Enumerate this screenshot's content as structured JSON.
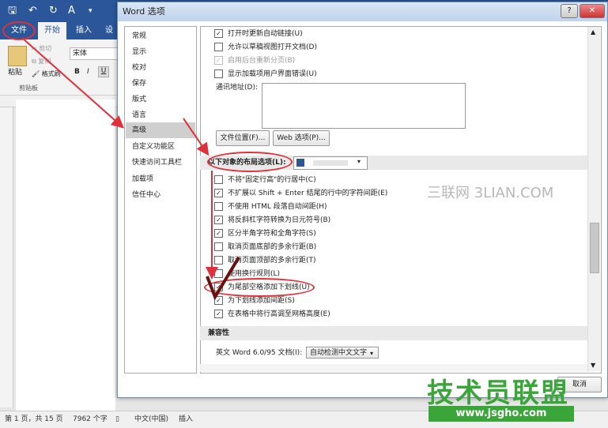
{
  "word": {
    "tabs": [
      "文件",
      "开始",
      "插入",
      "设"
    ],
    "font_name": "宋体",
    "paste_label": "粘贴",
    "cut_label": "剪切",
    "copy_label": "复制",
    "format_painter_label": "格式刷",
    "clipboard_label": "剪贴板",
    "format_buttons": [
      "B",
      "I",
      "U"
    ]
  },
  "status": {
    "page": "第 1 页，共 15 页",
    "words": "7962 个字",
    "language": "中文(中国)",
    "mode": "插入"
  },
  "dialog": {
    "title": "Word 选项",
    "help": "?",
    "close": "✕",
    "cancel_fragment": "取消"
  },
  "nav_items": [
    "常规",
    "显示",
    "校对",
    "保存",
    "版式",
    "语言",
    "高级",
    "自定义功能区",
    "快速访问工具栏",
    "加载项",
    "信任中心"
  ],
  "options_top": [
    {
      "label": "打开时更新自动链接(U)",
      "checked": true,
      "disabled": false
    },
    {
      "label": "允许以草稿视图打开文档(D)",
      "checked": false,
      "disabled": false
    },
    {
      "label": "启用后台重新分页(B)",
      "checked": true,
      "disabled": true
    },
    {
      "label": "显示加载项用户界面错误(U)",
      "checked": false,
      "disabled": false
    }
  ],
  "mail_address_label": "通讯地址(D):",
  "file_locations_button": "文件位置(F)...",
  "web_options_button": "Web 选项(P)...",
  "layout_section_label": "以下对象的布局选项(L):",
  "layout_options": [
    {
      "label": "不将\"固定行高\"的行居中(C)",
      "checked": false
    },
    {
      "label": "不扩展以 Shift + Enter 结尾的行中的字符间距(E)",
      "checked": true
    },
    {
      "label": "不使用 HTML 段落自动间距(H)",
      "checked": false
    },
    {
      "label": "将反斜杠字符转换为日元符号(B)",
      "checked": true
    },
    {
      "label": "区分半角字符和全角字符(S)",
      "checked": true
    },
    {
      "label": "取消页面底部的多余行距(B)",
      "checked": false
    },
    {
      "label": "取消页面顶部的多余行距(T)",
      "checked": false
    },
    {
      "label": "使用换行规则(L)",
      "checked": false
    },
    {
      "label": "为尾部空格添加下划线(U)",
      "checked": true
    },
    {
      "label": "为下划线添加间距(S)",
      "checked": true
    },
    {
      "label": "在表格中将行高调至网格高度(E)",
      "checked": true
    }
  ],
  "compat_section_label": "兼容性",
  "compat_label": "英文 Word 6.0/95 文档(I):",
  "compat_value": "自动检测中文文字",
  "watermarks": {
    "sanlian": "三联网 3LIAN.COM",
    "jsgho_title": "技术员联盟",
    "jsgho_url": "www.jsgho.com"
  },
  "colors": {
    "word_blue": "#2b579a",
    "annotation_red": "#e0303a",
    "jsgho_green": "#3aa538"
  }
}
